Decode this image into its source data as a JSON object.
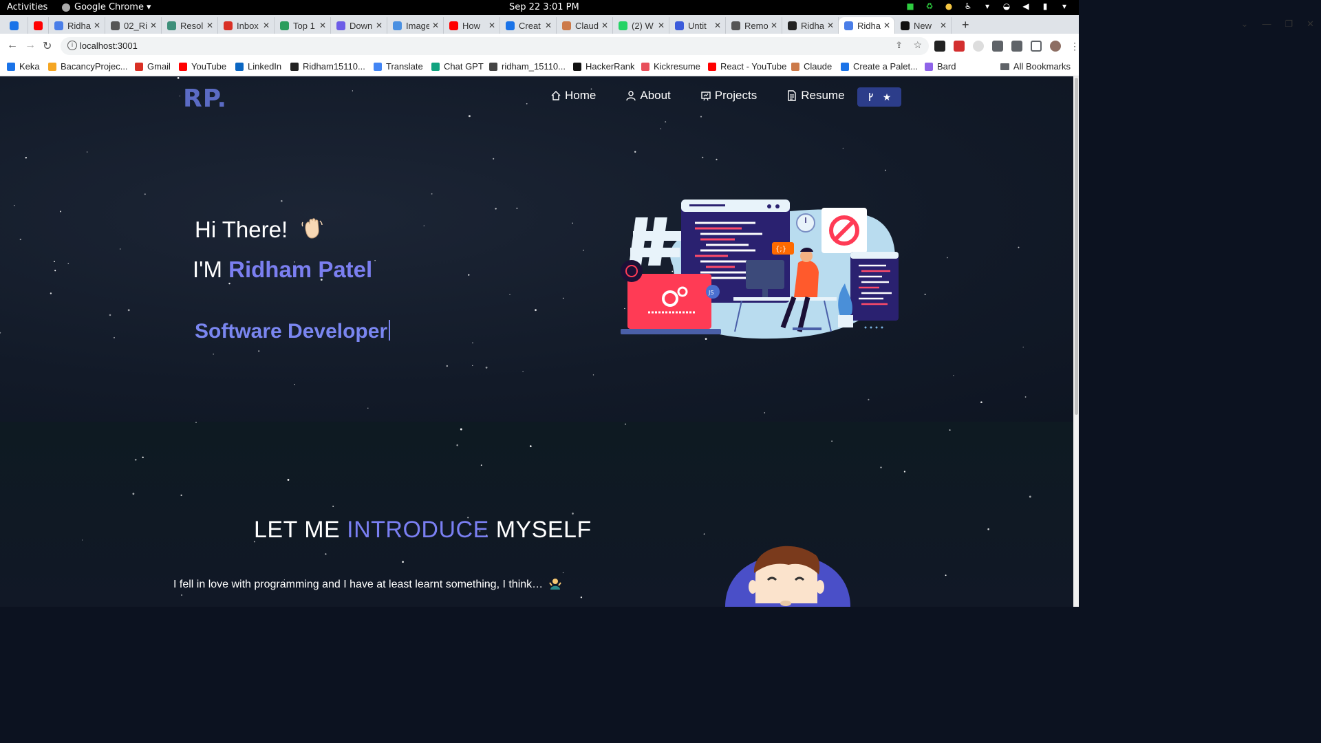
{
  "os": {
    "activities": "Activities",
    "app_name": "Google Chrome",
    "clock": "Sep 22  3:01 PM"
  },
  "browser": {
    "tabs": [
      {
        "label": "",
        "color": "#1a73e8"
      },
      {
        "label": "",
        "color": "#ff0000"
      },
      {
        "label": "Ridha",
        "color": "#4a7ee8"
      },
      {
        "label": "02_Ri",
        "color": "#555555"
      },
      {
        "label": "Resol",
        "color": "#3d8f7a"
      },
      {
        "label": "Inbox",
        "color": "#d93025"
      },
      {
        "label": "Top 1",
        "color": "#2a9d5c"
      },
      {
        "label": "Down",
        "color": "#6c5ce7"
      },
      {
        "label": "Image",
        "color": "#4a90e2"
      },
      {
        "label": "How",
        "color": "#ff0000"
      },
      {
        "label": "Creat",
        "color": "#1a73e8"
      },
      {
        "label": "Claud",
        "color": "#cc7a4a"
      },
      {
        "label": "(2) W",
        "color": "#25d366"
      },
      {
        "label": "Untit",
        "color": "#3b5bdb"
      },
      {
        "label": "Remo",
        "color": "#555555"
      },
      {
        "label": "Ridha",
        "color": "#222222"
      },
      {
        "label": "Ridha",
        "color": "#4a7ee8"
      },
      {
        "label": "New",
        "color": "#111111"
      }
    ],
    "active_tab_index": 16,
    "url": "localhost:3001",
    "bookmarks": [
      {
        "label": "Keka",
        "color": "#1a73e8"
      },
      {
        "label": "BacancyProjec...",
        "color": "#f5a623"
      },
      {
        "label": "Gmail",
        "color": "#d93025"
      },
      {
        "label": "YouTube",
        "color": "#ff0000"
      },
      {
        "label": "LinkedIn",
        "color": "#0a66c2"
      },
      {
        "label": "Ridham15110...",
        "color": "#222222"
      },
      {
        "label": "Translate",
        "color": "#4285f4"
      },
      {
        "label": "Chat GPT",
        "color": "#10a37f"
      },
      {
        "label": "ridham_15110...",
        "color": "#444444"
      },
      {
        "label": "HackerRank",
        "color": "#111111"
      },
      {
        "label": "Kickresume",
        "color": "#e8505b"
      },
      {
        "label": "React - YouTube",
        "color": "#ff0000"
      },
      {
        "label": "Claude",
        "color": "#cc7a4a"
      },
      {
        "label": "Create a Palet...",
        "color": "#1a73e8"
      },
      {
        "label": "Bard",
        "color": "#8e63e8"
      }
    ],
    "all_bookmarks": "All Bookmarks"
  },
  "page": {
    "logo": "RP.",
    "nav": [
      {
        "label": "Home",
        "icon": "home-icon"
      },
      {
        "label": "About",
        "icon": "user-icon"
      },
      {
        "label": "Projects",
        "icon": "projects-icon"
      },
      {
        "label": "Resume",
        "icon": "document-icon"
      }
    ],
    "github_button_icons": [
      "fork-icon",
      "star-icon"
    ],
    "hero": {
      "greeting": "Hi There!",
      "im": "I'M",
      "name": "Ridham Patel",
      "role": "Software Developer"
    },
    "intro": {
      "title_part1": "LET ME",
      "title_accent": "INTRODUCE",
      "title_part2": "MYSELF",
      "text": "I fell in love with programming and I have at least learnt something, I think…"
    }
  },
  "colors": {
    "accent": "#7a7ff2",
    "logo": "#5b6bc4",
    "github_button": "#2c3d8a",
    "background": "#121a28"
  }
}
